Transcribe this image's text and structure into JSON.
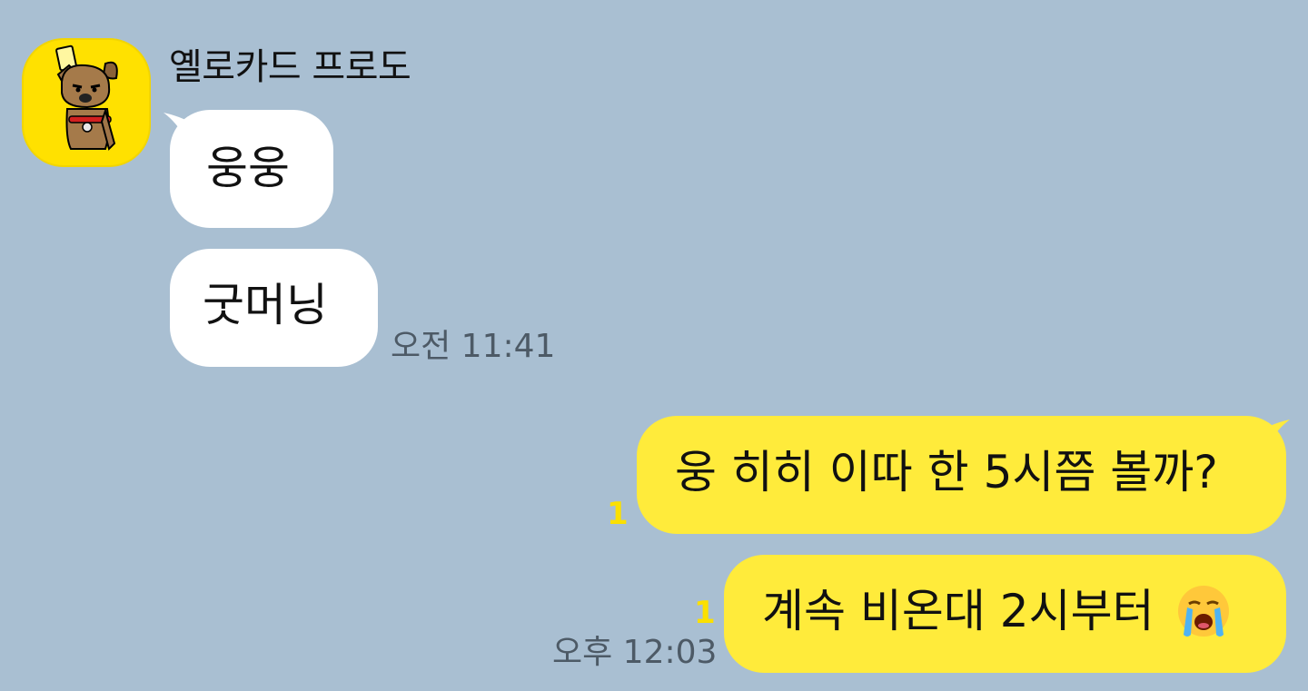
{
  "conversation": {
    "sender": {
      "name": "옐로카드 프로도",
      "avatar": "dog-character-holding-yellow-card"
    },
    "incoming_messages": [
      {
        "text": "웅웅"
      },
      {
        "text": "굿머닝",
        "time": "오전 11:41"
      }
    ],
    "outgoing_messages": [
      {
        "text": "웅 히히 이따 한 5시쯤 볼까?",
        "unread": "1"
      },
      {
        "text": "계속 비온대 2시부터",
        "emoji": "loudly-crying-face-emoji",
        "unread": "1",
        "time": "오후 12:03"
      }
    ]
  },
  "colors": {
    "background": "#a9bfd2",
    "incoming_bubble": "#ffffff",
    "outgoing_bubble": "#ffeb3b",
    "unread_count": "#fbe000",
    "avatar_bg": "#ffe100",
    "time_text": "#4d5a66"
  }
}
